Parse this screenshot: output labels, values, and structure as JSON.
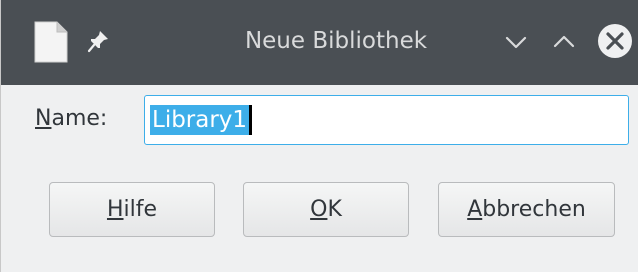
{
  "window": {
    "title": "Neue Bibliothek",
    "icons": {
      "app": "document-icon",
      "pin": "pin-icon",
      "minimize": "chevron-down-icon",
      "maximize": "chevron-up-icon",
      "close": "close-circle-icon"
    }
  },
  "form": {
    "name_label_mnemonic": "N",
    "name_label_rest": "ame:",
    "name_value": "Library1"
  },
  "buttons": {
    "help_mnemonic": "H",
    "help_rest": "ilfe",
    "ok_mnemonic": "O",
    "ok_rest": "K",
    "cancel_mnemonic": "A",
    "cancel_rest": "bbrechen"
  },
  "colors": {
    "titlebar": "#4a4f54",
    "accent": "#3daee9",
    "background": "#eff0f1",
    "text": "#31363b"
  }
}
